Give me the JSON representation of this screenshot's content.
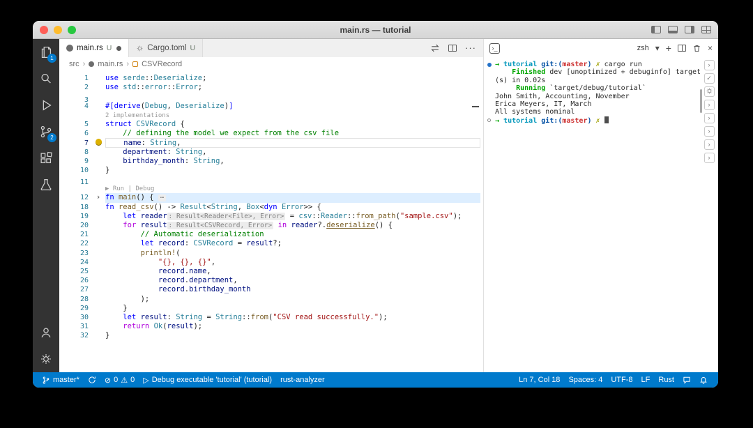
{
  "window": {
    "title": "main.rs — tutorial"
  },
  "activity_bar": {
    "explorer_badge": "1",
    "scm_badge": "2"
  },
  "tabs": [
    {
      "label": "main.rs",
      "git": "U",
      "dirty": true
    },
    {
      "label": "Cargo.toml",
      "git": "U"
    }
  ],
  "breadcrumb": {
    "items": [
      "src",
      "main.rs",
      "CSVRecord"
    ]
  },
  "editor": {
    "rows": [
      {
        "n": "1",
        "seg": [
          [
            "use ",
            "kw"
          ],
          [
            "serde",
            "ns"
          ],
          [
            "::",
            "pl"
          ],
          [
            "Deserialize",
            "ty"
          ],
          [
            ";",
            "pl"
          ]
        ]
      },
      {
        "n": "2",
        "seg": [
          [
            "use ",
            "kw"
          ],
          [
            "std",
            "ns"
          ],
          [
            "::",
            "pl"
          ],
          [
            "error",
            "ns"
          ],
          [
            "::",
            "pl"
          ],
          [
            "Error",
            "ty"
          ],
          [
            ";",
            "pl"
          ]
        ]
      },
      {
        "n": "3",
        "seg": []
      },
      {
        "n": "4",
        "seg": [
          [
            "#[",
            "attr"
          ],
          [
            "derive",
            "attr"
          ],
          [
            "(",
            "pl"
          ],
          [
            "Debug",
            "ty"
          ],
          [
            ", ",
            "pl"
          ],
          [
            "Deserialize",
            "ty"
          ],
          [
            ")",
            "pl"
          ],
          [
            "]",
            "attr"
          ]
        ]
      },
      {
        "lens": "2 implementations"
      },
      {
        "n": "5",
        "seg": [
          [
            "struct ",
            "kw"
          ],
          [
            "CSVRecord",
            "ty"
          ],
          [
            " {",
            "pl"
          ]
        ]
      },
      {
        "n": "6",
        "seg": [
          [
            "    // defining the model we expect from the csv file",
            "com"
          ]
        ]
      },
      {
        "n": "7",
        "cur": true,
        "bulb": true,
        "seg": [
          [
            "    ",
            "pl"
          ],
          [
            "name",
            "var"
          ],
          [
            ": ",
            "pl"
          ],
          [
            "String",
            "ty"
          ],
          [
            ",",
            "pl"
          ]
        ]
      },
      {
        "n": "8",
        "seg": [
          [
            "    ",
            "pl"
          ],
          [
            "department",
            "var"
          ],
          [
            ": ",
            "pl"
          ],
          [
            "String",
            "ty"
          ],
          [
            ",",
            "pl"
          ]
        ]
      },
      {
        "n": "9",
        "seg": [
          [
            "    ",
            "pl"
          ],
          [
            "birthday_month",
            "var"
          ],
          [
            ": ",
            "pl"
          ],
          [
            "String",
            "ty"
          ],
          [
            ",",
            "pl"
          ]
        ]
      },
      {
        "n": "10",
        "seg": [
          [
            "}",
            "pl"
          ]
        ]
      },
      {
        "n": "11",
        "seg": []
      },
      {
        "lens": "▶ Run | Debug"
      },
      {
        "n": "12",
        "fold": true,
        "foldbg": true,
        "seg": [
          [
            "fn ",
            "kw"
          ],
          [
            "main",
            "fn"
          ],
          [
            "() { ",
            "pl"
          ],
          [
            "⋯",
            "folddots"
          ]
        ]
      },
      {
        "n": "18",
        "seg": [
          [
            "fn ",
            "kw"
          ],
          [
            "read_csv",
            "fn"
          ],
          [
            "() -> ",
            "pl"
          ],
          [
            "Result",
            "ty"
          ],
          [
            "<",
            "pl"
          ],
          [
            "String",
            "ty"
          ],
          [
            ", ",
            "pl"
          ],
          [
            "Box",
            "ty"
          ],
          [
            "<",
            "pl"
          ],
          [
            "dyn ",
            "kw"
          ],
          [
            "Error",
            "ty"
          ],
          [
            ">> {",
            "pl"
          ]
        ]
      },
      {
        "n": "19",
        "seg": [
          [
            "    ",
            "pl"
          ],
          [
            "let ",
            "kw"
          ],
          [
            "reader",
            "var"
          ],
          [
            ": Result<Reader<File>, Error>",
            "inlay"
          ],
          [
            " = ",
            "pl"
          ],
          [
            "csv",
            "ns"
          ],
          [
            "::",
            "pl"
          ],
          [
            "Reader",
            "ty"
          ],
          [
            "::",
            "pl"
          ],
          [
            "from_path",
            "fn"
          ],
          [
            "(",
            "pl"
          ],
          [
            "\"sample.csv\"",
            "str"
          ],
          [
            ");",
            "pl"
          ]
        ]
      },
      {
        "n": "20",
        "seg": [
          [
            "    ",
            "pl"
          ],
          [
            "for ",
            "ctrl"
          ],
          [
            "result",
            "var"
          ],
          [
            ": Result<CSVRecord, Error>",
            "inlay"
          ],
          [
            " in ",
            "ctrl"
          ],
          [
            "reader",
            "var"
          ],
          [
            "?.",
            "pl"
          ],
          [
            "deserialize",
            "fnu"
          ],
          [
            "() {",
            "pl"
          ]
        ]
      },
      {
        "n": "21",
        "seg": [
          [
            "        // Automatic deserialization",
            "com"
          ]
        ]
      },
      {
        "n": "22",
        "seg": [
          [
            "        ",
            "pl"
          ],
          [
            "let ",
            "kw"
          ],
          [
            "record",
            "var"
          ],
          [
            ": ",
            "pl"
          ],
          [
            "CSVRecord",
            "ty"
          ],
          [
            " = ",
            "pl"
          ],
          [
            "result",
            "var"
          ],
          [
            "?;",
            "pl"
          ]
        ]
      },
      {
        "n": "23",
        "seg": [
          [
            "        ",
            "pl"
          ],
          [
            "println!",
            "fn"
          ],
          [
            "(",
            "pl"
          ]
        ]
      },
      {
        "n": "24",
        "seg": [
          [
            "            ",
            "pl"
          ],
          [
            "\"{}, {}, {}\"",
            "str"
          ],
          [
            ",",
            "pl"
          ]
        ]
      },
      {
        "n": "25",
        "seg": [
          [
            "            ",
            "pl"
          ],
          [
            "record",
            "var"
          ],
          [
            ".",
            "pl"
          ],
          [
            "name",
            "var"
          ],
          [
            ",",
            "pl"
          ]
        ]
      },
      {
        "n": "26",
        "seg": [
          [
            "            ",
            "pl"
          ],
          [
            "record",
            "var"
          ],
          [
            ".",
            "pl"
          ],
          [
            "department",
            "var"
          ],
          [
            ",",
            "pl"
          ]
        ]
      },
      {
        "n": "27",
        "seg": [
          [
            "            ",
            "pl"
          ],
          [
            "record",
            "var"
          ],
          [
            ".",
            "pl"
          ],
          [
            "birthday_month",
            "var"
          ]
        ]
      },
      {
        "n": "28",
        "seg": [
          [
            "        );",
            "pl"
          ]
        ]
      },
      {
        "n": "29",
        "seg": [
          [
            "    }",
            "pl"
          ]
        ]
      },
      {
        "n": "30",
        "seg": [
          [
            "    ",
            "pl"
          ],
          [
            "let ",
            "kw"
          ],
          [
            "result",
            "var"
          ],
          [
            ": ",
            "pl"
          ],
          [
            "String",
            "ty"
          ],
          [
            " = ",
            "pl"
          ],
          [
            "String",
            "ty"
          ],
          [
            "::",
            "pl"
          ],
          [
            "from",
            "fn"
          ],
          [
            "(",
            "pl"
          ],
          [
            "\"CSV read successfully.\"",
            "str"
          ],
          [
            ");",
            "pl"
          ]
        ]
      },
      {
        "n": "31",
        "seg": [
          [
            "    ",
            "pl"
          ],
          [
            "return ",
            "ctrl"
          ],
          [
            "Ok",
            "ty"
          ],
          [
            "(",
            "pl"
          ],
          [
            "result",
            "var"
          ],
          [
            ");",
            "pl"
          ]
        ]
      },
      {
        "n": "32",
        "seg": [
          [
            "}",
            "pl"
          ]
        ]
      }
    ]
  },
  "terminal": {
    "shell": "zsh",
    "lines": [
      {
        "marker": "run",
        "seg": [
          [
            "→ ",
            "tgreen b"
          ],
          [
            "tutorial ",
            "tcyan b"
          ],
          [
            "git:(",
            "tblue b"
          ],
          [
            "master",
            "tred b"
          ],
          [
            ") ",
            "tblue b"
          ],
          [
            "✗ ",
            "tyellow b"
          ],
          [
            "cargo run",
            "tfg"
          ]
        ]
      },
      {
        "seg": [
          [
            "    Finished",
            "tgreen b"
          ],
          [
            " dev [unoptimized + debuginfo] target",
            "tfg"
          ]
        ]
      },
      {
        "seg": [
          [
            "(s) in 0.02s",
            "tfg"
          ]
        ]
      },
      {
        "seg": [
          [
            "     Running",
            "tgreen b"
          ],
          [
            " `target/debug/tutorial`",
            "tfg"
          ]
        ]
      },
      {
        "seg": [
          [
            "John Smith, Accounting, November",
            "tfg"
          ]
        ]
      },
      {
        "seg": [
          [
            "Erica Meyers, IT, March",
            "tfg"
          ]
        ]
      },
      {
        "seg": [
          [
            "All systems nominal",
            "tfg"
          ]
        ]
      },
      {
        "marker": "idle",
        "cursor": true,
        "seg": [
          [
            "→ ",
            "tgreen b"
          ],
          [
            "tutorial ",
            "tcyan b"
          ],
          [
            "git:(",
            "tblue b"
          ],
          [
            "master",
            "tred b"
          ],
          [
            ") ",
            "tblue b"
          ],
          [
            "✗ ",
            "tyellow b"
          ]
        ]
      }
    ]
  },
  "status_bar": {
    "branch": "master*",
    "errors": "0",
    "warnings": "0",
    "debug_label": "Debug executable 'tutorial' (tutorial)",
    "lsp": "rust-analyzer",
    "cursor": "Ln 7, Col 18",
    "indent": "Spaces: 4",
    "encoding": "UTF-8",
    "eol": "LF",
    "language": "Rust"
  }
}
